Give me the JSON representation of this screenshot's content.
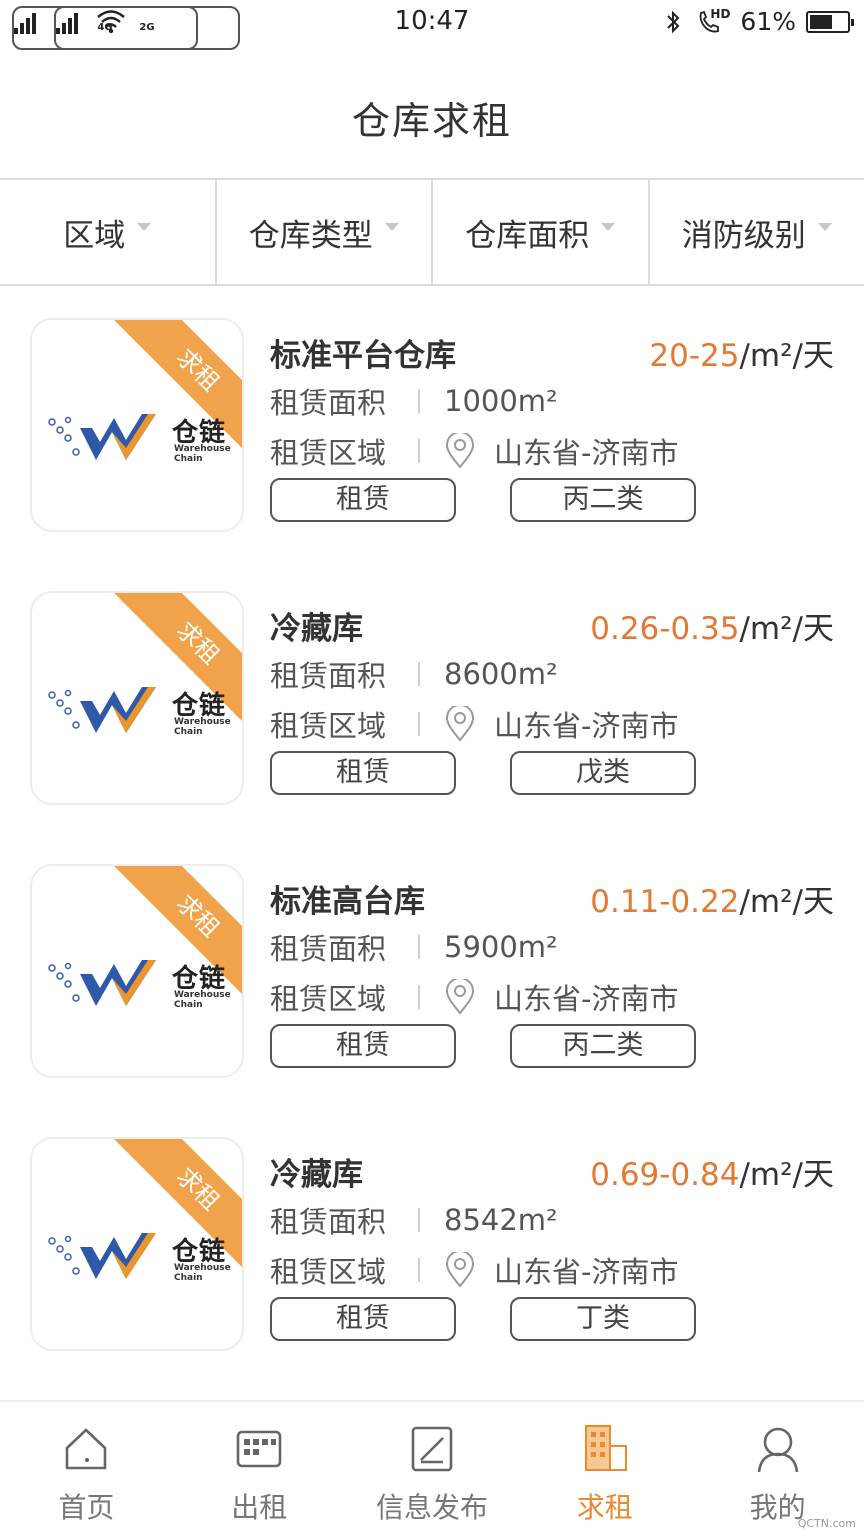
{
  "status": {
    "signal1": "4G",
    "signal2": "2G",
    "time": "10:47",
    "hd": "HD",
    "battery": "61%",
    "battery_level": 0.61
  },
  "header": {
    "title": "仓库求租"
  },
  "filters": [
    {
      "label": "区域"
    },
    {
      "label": "仓库类型"
    },
    {
      "label": "仓库面积"
    },
    {
      "label": "消防级别"
    }
  ],
  "labels": {
    "area": "租赁面积",
    "region": "租赁区域",
    "badge": "求租",
    "unit": "/m²/天",
    "logo_cn": "仓链",
    "logo_en1": "Warehouse",
    "logo_en2": "Chain"
  },
  "listings": [
    {
      "title": "标准平台仓库",
      "price": "20-25",
      "area": "1000m²",
      "region": "山东省-济南市",
      "type": "租赁",
      "grade": "丙二类"
    },
    {
      "title": "冷藏库",
      "price": "0.26-0.35",
      "area": "8600m²",
      "region": "山东省-济南市",
      "type": "租赁",
      "grade": "戊类"
    },
    {
      "title": "标准高台库",
      "price": "0.11-0.22",
      "area": "5900m²",
      "region": "山东省-济南市",
      "type": "租赁",
      "grade": "丙二类"
    },
    {
      "title": "冷藏库",
      "price": "0.69-0.84",
      "area": "8542m²",
      "region": "山东省-济南市",
      "type": "租赁",
      "grade": "丁类"
    }
  ],
  "nav": [
    {
      "label": "首页",
      "icon": "home-icon"
    },
    {
      "label": "出租",
      "icon": "warehouse-icon"
    },
    {
      "label": "信息发布",
      "icon": "edit-icon"
    },
    {
      "label": "求租",
      "icon": "building-icon",
      "active": true
    },
    {
      "label": "我的",
      "icon": "user-icon"
    }
  ],
  "watermark": "QCTN.com",
  "colors": {
    "accent": "#e98a2d",
    "price": "#e07a34",
    "badge": "#f0a34a"
  }
}
